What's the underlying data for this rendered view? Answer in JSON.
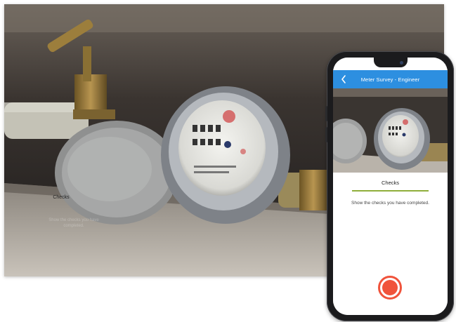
{
  "background_overlay": {
    "title": "Checks",
    "description": "Show the checks you have completed."
  },
  "app": {
    "title": "Meter Survey - Engineer",
    "back_icon": "chevron-left-icon",
    "accent_color": "#2d8fe0"
  },
  "checks_panel": {
    "title": "Checks",
    "description": "Show the checks you have completed.",
    "underline_color": "#8fae3a"
  },
  "record_button": {
    "icon": "record-icon",
    "color": "#f0533b"
  }
}
